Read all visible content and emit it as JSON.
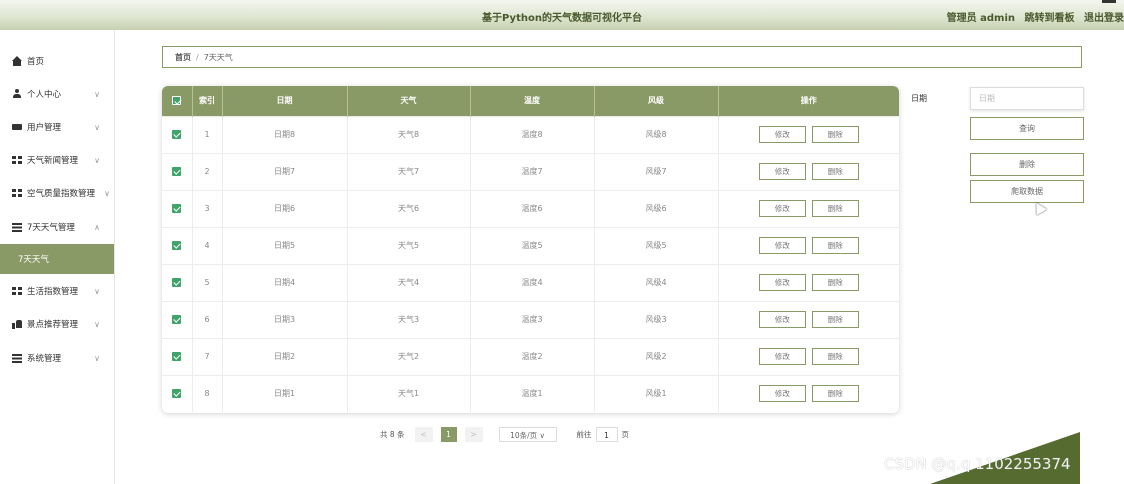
{
  "header": {
    "title": "基于Python的天气数据可视化平台",
    "admin": "管理员 admin",
    "dashboard_link": "跳转到看板",
    "logout": "退出登录"
  },
  "sidebar": {
    "items": [
      {
        "label": "首页",
        "icon": "home-icon"
      },
      {
        "label": "个人中心",
        "icon": "user-icon"
      },
      {
        "label": "用户管理",
        "icon": "card-icon"
      },
      {
        "label": "天气新闻管理",
        "icon": "grid-icon"
      },
      {
        "label": "空气质量指数管理",
        "icon": "grid-icon"
      },
      {
        "label": "7天天气管理",
        "icon": "list-icon"
      },
      {
        "label": "7天天气",
        "icon": ""
      },
      {
        "label": "生活指数管理",
        "icon": "grid-icon"
      },
      {
        "label": "景点推荐管理",
        "icon": "thumb-icon"
      },
      {
        "label": "系统管理",
        "icon": "list-icon"
      }
    ]
  },
  "breadcrumb": {
    "home": "首页",
    "separator": "/",
    "current": "7天天气"
  },
  "table": {
    "headers": [
      "索引",
      "日期",
      "天气",
      "温度",
      "风级",
      "操作"
    ],
    "edit_label": "修改",
    "delete_label": "删除",
    "rows": [
      {
        "index": "1",
        "date": "日期8",
        "weather": "天气8",
        "temp": "温度8",
        "wind": "风级8"
      },
      {
        "index": "2",
        "date": "日期7",
        "weather": "天气7",
        "temp": "温度7",
        "wind": "风级7"
      },
      {
        "index": "3",
        "date": "日期6",
        "weather": "天气6",
        "temp": "温度6",
        "wind": "风级6"
      },
      {
        "index": "4",
        "date": "日期5",
        "weather": "天气5",
        "temp": "温度5",
        "wind": "风级5"
      },
      {
        "index": "5",
        "date": "日期4",
        "weather": "天气4",
        "temp": "温度4",
        "wind": "风级4"
      },
      {
        "index": "6",
        "date": "日期3",
        "weather": "天气3",
        "temp": "温度3",
        "wind": "风级3"
      },
      {
        "index": "7",
        "date": "日期2",
        "weather": "天气2",
        "temp": "温度2",
        "wind": "风级2"
      },
      {
        "index": "8",
        "date": "日期1",
        "weather": "天气1",
        "temp": "温度1",
        "wind": "风级1"
      }
    ]
  },
  "search": {
    "label": "日期",
    "placeholder": "日期",
    "query_button": "查询",
    "delete_button": "删除",
    "fetch_button": "爬取数据"
  },
  "pagination": {
    "total": "共 8 条",
    "prev": "<",
    "current": "1",
    "next": ">",
    "page_size": "10条/页 ∨",
    "goto": "前往",
    "goto_value": "1",
    "page_unit": "页"
  },
  "watermark": "CSDN @q.q 1102255374",
  "colors": {
    "accent": "#8a9a66",
    "checkbox": "#3fa46a",
    "deco": "#556b2f"
  }
}
